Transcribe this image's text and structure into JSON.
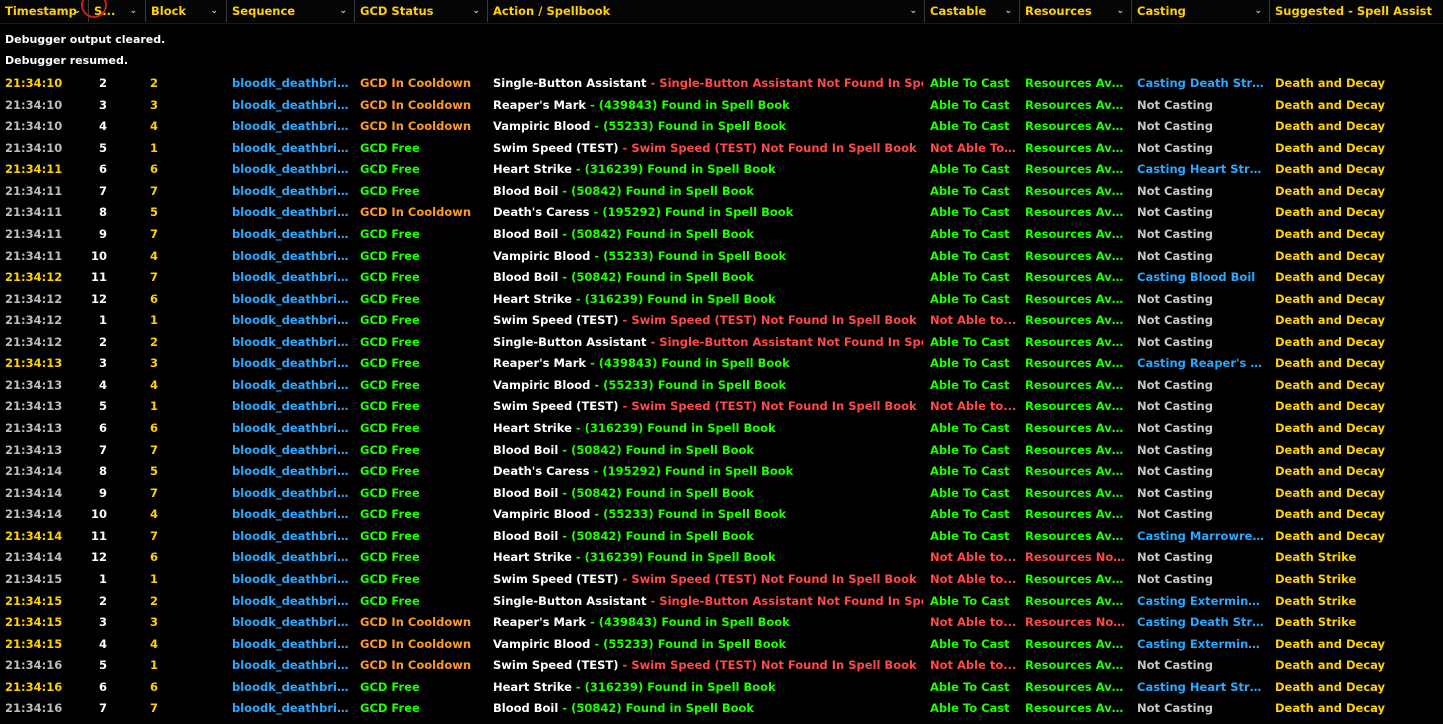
{
  "columns": [
    {
      "key": "timestamp",
      "label": "Timestamp",
      "chevron": "⌄"
    },
    {
      "key": "step",
      "label": "S...",
      "chevron": "⌄"
    },
    {
      "key": "block",
      "label": "Block",
      "chevron": "⌄"
    },
    {
      "key": "sequence",
      "label": "Sequence",
      "chevron": "⌄"
    },
    {
      "key": "gcd",
      "label": "GCD Status",
      "chevron": "⌄"
    },
    {
      "key": "action",
      "label": "Action / Spellbook",
      "chevron": "⌄"
    },
    {
      "key": "castable",
      "label": "Castable",
      "chevron": "⌄"
    },
    {
      "key": "resources",
      "label": "Resources",
      "chevron": "⌄"
    },
    {
      "key": "casting",
      "label": "Casting",
      "chevron": "⌄"
    },
    {
      "key": "suggested",
      "label": "Suggested - Spell Assist",
      "chevron": ""
    }
  ],
  "messages": [
    "Debugger output cleared.",
    "Debugger resumed."
  ],
  "colors": {
    "header": "#ffd100",
    "green": "#1eff00",
    "orange": "#ff9a22",
    "red": "#ff4848",
    "blue": "#2aa8ff",
    "grey": "#c8c8c8",
    "background": "#000000"
  },
  "rows": [
    {
      "ts": "21:34:10",
      "hl": true,
      "step": "2",
      "block": "2",
      "seq": "bloodk_deathbring...",
      "gcd": "GCD In Cooldown",
      "gcd_state": "cooldown",
      "spell": "Single-Button Assistant",
      "spell_id": "",
      "found": false,
      "spell_text": "Single-Button Assistant Not Found In Spell Book",
      "castable": "Able To Cast",
      "castable_ok": true,
      "resources": "Resources Avai...",
      "resources_ok": true,
      "casting": "Casting Death Strike",
      "is_casting": true,
      "suggested": "Death and Decay"
    },
    {
      "ts": "21:34:10",
      "hl": false,
      "step": "3",
      "block": "3",
      "seq": "bloodk_deathbring...",
      "gcd": "GCD In Cooldown",
      "gcd_state": "cooldown",
      "spell": "Reaper's Mark",
      "spell_id": "(439843)",
      "found": true,
      "spell_text": "Found in Spell Book",
      "castable": "Able To Cast",
      "castable_ok": true,
      "resources": "Resources Avai...",
      "resources_ok": true,
      "casting": "Not Casting",
      "is_casting": false,
      "suggested": "Death and Decay"
    },
    {
      "ts": "21:34:10",
      "hl": false,
      "step": "4",
      "block": "4",
      "seq": "bloodk_deathbring...",
      "gcd": "GCD In Cooldown",
      "gcd_state": "cooldown",
      "spell": "Vampiric Blood",
      "spell_id": "(55233)",
      "found": true,
      "spell_text": "Found in Spell Book",
      "castable": "Able To Cast",
      "castable_ok": true,
      "resources": "Resources Avai...",
      "resources_ok": true,
      "casting": "Not Casting",
      "is_casting": false,
      "suggested": "Death and Decay"
    },
    {
      "ts": "21:34:10",
      "hl": false,
      "step": "5",
      "block": "1",
      "seq": "bloodk_deathbring...",
      "gcd": "GCD Free",
      "gcd_state": "free",
      "spell": "Swim Speed (TEST)",
      "spell_id": "",
      "found": false,
      "spell_text": "Swim Speed (TEST) Not Found In Spell Book",
      "castable": "Not Able To Cast",
      "castable_ok": false,
      "resources": "Resources Avai...",
      "resources_ok": true,
      "casting": "Not Casting",
      "is_casting": false,
      "suggested": "Death and Decay"
    },
    {
      "ts": "21:34:11",
      "hl": true,
      "step": "6",
      "block": "6",
      "seq": "bloodk_deathbring...",
      "gcd": "GCD Free",
      "gcd_state": "free",
      "spell": "Heart Strike",
      "spell_id": "(316239)",
      "found": true,
      "spell_text": "Found in Spell Book",
      "castable": "Able To Cast",
      "castable_ok": true,
      "resources": "Resources Avai...",
      "resources_ok": true,
      "casting": "Casting Heart Strike",
      "is_casting": true,
      "suggested": "Death and Decay"
    },
    {
      "ts": "21:34:11",
      "hl": false,
      "step": "7",
      "block": "7",
      "seq": "bloodk_deathbring...",
      "gcd": "GCD Free",
      "gcd_state": "free",
      "spell": "Blood Boil",
      "spell_id": "(50842)",
      "found": true,
      "spell_text": "Found in Spell Book",
      "castable": "Able To Cast",
      "castable_ok": true,
      "resources": "Resources Avai...",
      "resources_ok": true,
      "casting": "Not Casting",
      "is_casting": false,
      "suggested": "Death and Decay"
    },
    {
      "ts": "21:34:11",
      "hl": false,
      "step": "8",
      "block": "5",
      "seq": "bloodk_deathbring...",
      "gcd": "GCD In Cooldown",
      "gcd_state": "cooldown",
      "spell": "Death's Caress",
      "spell_id": "(195292)",
      "found": true,
      "spell_text": "Found in Spell Book",
      "castable": "Able To Cast",
      "castable_ok": true,
      "resources": "Resources Avai...",
      "resources_ok": true,
      "casting": "Not Casting",
      "is_casting": false,
      "suggested": "Death and Decay"
    },
    {
      "ts": "21:34:11",
      "hl": false,
      "step": "9",
      "block": "7",
      "seq": "bloodk_deathbring...",
      "gcd": "GCD Free",
      "gcd_state": "free",
      "spell": "Blood Boil",
      "spell_id": "(50842)",
      "found": true,
      "spell_text": "Found in Spell Book",
      "castable": "Able To Cast",
      "castable_ok": true,
      "resources": "Resources Avai...",
      "resources_ok": true,
      "casting": "Not Casting",
      "is_casting": false,
      "suggested": "Death and Decay"
    },
    {
      "ts": "21:34:11",
      "hl": false,
      "step": "10",
      "block": "4",
      "seq": "bloodk_deathbring...",
      "gcd": "GCD Free",
      "gcd_state": "free",
      "spell": "Vampiric Blood",
      "spell_id": "(55233)",
      "found": true,
      "spell_text": "Found in Spell Book",
      "castable": "Able To Cast",
      "castable_ok": true,
      "resources": "Resources Avai...",
      "resources_ok": true,
      "casting": "Not Casting",
      "is_casting": false,
      "suggested": "Death and Decay"
    },
    {
      "ts": "21:34:12",
      "hl": true,
      "step": "11",
      "block": "7",
      "seq": "bloodk_deathbring...",
      "gcd": "GCD Free",
      "gcd_state": "free",
      "spell": "Blood Boil",
      "spell_id": "(50842)",
      "found": true,
      "spell_text": "Found in Spell Book",
      "castable": "Able To Cast",
      "castable_ok": true,
      "resources": "Resources Avai...",
      "resources_ok": true,
      "casting": "Casting Blood Boil",
      "is_casting": true,
      "suggested": "Death and Decay"
    },
    {
      "ts": "21:34:12",
      "hl": false,
      "step": "12",
      "block": "6",
      "seq": "bloodk_deathbring...",
      "gcd": "GCD Free",
      "gcd_state": "free",
      "spell": "Heart Strike",
      "spell_id": "(316239)",
      "found": true,
      "spell_text": "Found in Spell Book",
      "castable": "Able To Cast",
      "castable_ok": true,
      "resources": "Resources Avai...",
      "resources_ok": true,
      "casting": "Not Casting",
      "is_casting": false,
      "suggested": "Death and Decay"
    },
    {
      "ts": "21:34:12",
      "hl": false,
      "step": "1",
      "block": "1",
      "seq": "bloodk_deathbring...",
      "gcd": "GCD Free",
      "gcd_state": "free",
      "spell": "Swim Speed (TEST)",
      "spell_id": "",
      "found": false,
      "spell_text": "Swim Speed (TEST) Not Found In Spell Book",
      "castable": "Not Able to...",
      "castable_ok": false,
      "resources": "Resources Avai...",
      "resources_ok": true,
      "casting": "Not Casting",
      "is_casting": false,
      "suggested": "Death and Decay"
    },
    {
      "ts": "21:34:12",
      "hl": false,
      "step": "2",
      "block": "2",
      "seq": "bloodk_deathbring...",
      "gcd": "GCD Free",
      "gcd_state": "free",
      "spell": "Single-Button Assistant",
      "spell_id": "",
      "found": false,
      "spell_text": "Single-Button Assistant Not Found In Spell Book",
      "castable": "Able To Cast",
      "castable_ok": true,
      "resources": "Resources Avai...",
      "resources_ok": true,
      "casting": "Not Casting",
      "is_casting": false,
      "suggested": "Death and Decay"
    },
    {
      "ts": "21:34:13",
      "hl": true,
      "step": "3",
      "block": "3",
      "seq": "bloodk_deathbring...",
      "gcd": "GCD Free",
      "gcd_state": "free",
      "spell": "Reaper's Mark",
      "spell_id": "(439843)",
      "found": true,
      "spell_text": "Found in Spell Book",
      "castable": "Able To Cast",
      "castable_ok": true,
      "resources": "Resources Avai...",
      "resources_ok": true,
      "casting": "Casting Reaper's Ma...",
      "is_casting": true,
      "suggested": "Death and Decay"
    },
    {
      "ts": "21:34:13",
      "hl": false,
      "step": "4",
      "block": "4",
      "seq": "bloodk_deathbring...",
      "gcd": "GCD Free",
      "gcd_state": "free",
      "spell": "Vampiric Blood",
      "spell_id": "(55233)",
      "found": true,
      "spell_text": "Found in Spell Book",
      "castable": "Able To Cast",
      "castable_ok": true,
      "resources": "Resources Avai...",
      "resources_ok": true,
      "casting": "Not Casting",
      "is_casting": false,
      "suggested": "Death and Decay"
    },
    {
      "ts": "21:34:13",
      "hl": false,
      "step": "5",
      "block": "1",
      "seq": "bloodk_deathbring...",
      "gcd": "GCD Free",
      "gcd_state": "free",
      "spell": "Swim Speed (TEST)",
      "spell_id": "",
      "found": false,
      "spell_text": "Swim Speed (TEST) Not Found In Spell Book",
      "castable": "Not Able to...",
      "castable_ok": false,
      "resources": "Resources Avai...",
      "resources_ok": true,
      "casting": "Not Casting",
      "is_casting": false,
      "suggested": "Death and Decay"
    },
    {
      "ts": "21:34:13",
      "hl": false,
      "step": "6",
      "block": "6",
      "seq": "bloodk_deathbring...",
      "gcd": "GCD Free",
      "gcd_state": "free",
      "spell": "Heart Strike",
      "spell_id": "(316239)",
      "found": true,
      "spell_text": "Found in Spell Book",
      "castable": "Able To Cast",
      "castable_ok": true,
      "resources": "Resources Avai...",
      "resources_ok": true,
      "casting": "Not Casting",
      "is_casting": false,
      "suggested": "Death and Decay"
    },
    {
      "ts": "21:34:13",
      "hl": false,
      "step": "7",
      "block": "7",
      "seq": "bloodk_deathbring...",
      "gcd": "GCD Free",
      "gcd_state": "free",
      "spell": "Blood Boil",
      "spell_id": "(50842)",
      "found": true,
      "spell_text": "Found in Spell Book",
      "castable": "Able To Cast",
      "castable_ok": true,
      "resources": "Resources Avai...",
      "resources_ok": true,
      "casting": "Not Casting",
      "is_casting": false,
      "suggested": "Death and Decay"
    },
    {
      "ts": "21:34:14",
      "hl": false,
      "step": "8",
      "block": "5",
      "seq": "bloodk_deathbring...",
      "gcd": "GCD Free",
      "gcd_state": "free",
      "spell": "Death's Caress",
      "spell_id": "(195292)",
      "found": true,
      "spell_text": "Found in Spell Book",
      "castable": "Able To Cast",
      "castable_ok": true,
      "resources": "Resources Avai...",
      "resources_ok": true,
      "casting": "Not Casting",
      "is_casting": false,
      "suggested": "Death and Decay"
    },
    {
      "ts": "21:34:14",
      "hl": false,
      "step": "9",
      "block": "7",
      "seq": "bloodk_deathbring...",
      "gcd": "GCD Free",
      "gcd_state": "free",
      "spell": "Blood Boil",
      "spell_id": "(50842)",
      "found": true,
      "spell_text": "Found in Spell Book",
      "castable": "Able To Cast",
      "castable_ok": true,
      "resources": "Resources Avai...",
      "resources_ok": true,
      "casting": "Not Casting",
      "is_casting": false,
      "suggested": "Death and Decay"
    },
    {
      "ts": "21:34:14",
      "hl": false,
      "step": "10",
      "block": "4",
      "seq": "bloodk_deathbring...",
      "gcd": "GCD Free",
      "gcd_state": "free",
      "spell": "Vampiric Blood",
      "spell_id": "(55233)",
      "found": true,
      "spell_text": "Found in Spell Book",
      "castable": "Able To Cast",
      "castable_ok": true,
      "resources": "Resources Avai...",
      "resources_ok": true,
      "casting": "Not Casting",
      "is_casting": false,
      "suggested": "Death and Decay"
    },
    {
      "ts": "21:34:14",
      "hl": true,
      "step": "11",
      "block": "7",
      "seq": "bloodk_deathbring...",
      "gcd": "GCD Free",
      "gcd_state": "free",
      "spell": "Blood Boil",
      "spell_id": "(50842)",
      "found": true,
      "spell_text": "Found in Spell Book",
      "castable": "Able To Cast",
      "castable_ok": true,
      "resources": "Resources Avai...",
      "resources_ok": true,
      "casting": "Casting Marrowrend",
      "is_casting": true,
      "suggested": "Death and Decay"
    },
    {
      "ts": "21:34:14",
      "hl": false,
      "step": "12",
      "block": "6",
      "seq": "bloodk_deathbring...",
      "gcd": "GCD Free",
      "gcd_state": "free",
      "spell": "Heart Strike",
      "spell_id": "(316239)",
      "found": true,
      "spell_text": "Found in Spell Book",
      "castable": "Not Able to...",
      "castable_ok": false,
      "resources": "Resources Not...",
      "resources_ok": false,
      "casting": "Not Casting",
      "is_casting": false,
      "suggested": "Death Strike"
    },
    {
      "ts": "21:34:15",
      "hl": false,
      "step": "1",
      "block": "1",
      "seq": "bloodk_deathbring...",
      "gcd": "GCD Free",
      "gcd_state": "free",
      "spell": "Swim Speed (TEST)",
      "spell_id": "",
      "found": false,
      "spell_text": "Swim Speed (TEST) Not Found In Spell Book",
      "castable": "Not Able to...",
      "castable_ok": false,
      "resources": "Resources Avai...",
      "resources_ok": true,
      "casting": "Not Casting",
      "is_casting": false,
      "suggested": "Death Strike"
    },
    {
      "ts": "21:34:15",
      "hl": true,
      "step": "2",
      "block": "2",
      "seq": "bloodk_deathbring...",
      "gcd": "GCD Free",
      "gcd_state": "free",
      "spell": "Single-Button Assistant",
      "spell_id": "",
      "found": false,
      "spell_text": "Single-Button Assistant Not Found In Spell Book",
      "castable": "Able To Cast",
      "castable_ok": true,
      "resources": "Resources Avai...",
      "resources_ok": true,
      "casting": "Casting Exterminate",
      "is_casting": true,
      "suggested": "Death Strike"
    },
    {
      "ts": "21:34:15",
      "hl": true,
      "step": "3",
      "block": "3",
      "seq": "bloodk_deathbring...",
      "gcd": "GCD In Cooldown",
      "gcd_state": "cooldown",
      "spell": "Reaper's Mark",
      "spell_id": "(439843)",
      "found": true,
      "spell_text": "Found in Spell Book",
      "castable": "Not Able to...",
      "castable_ok": false,
      "resources": "Resources Not...",
      "resources_ok": false,
      "casting": "Casting Death Strike",
      "is_casting": true,
      "suggested": "Death Strike"
    },
    {
      "ts": "21:34:15",
      "hl": true,
      "step": "4",
      "block": "4",
      "seq": "bloodk_deathbring...",
      "gcd": "GCD In Cooldown",
      "gcd_state": "cooldown",
      "spell": "Vampiric Blood",
      "spell_id": "(55233)",
      "found": true,
      "spell_text": "Found in Spell Book",
      "castable": "Able To Cast",
      "castable_ok": true,
      "resources": "Resources Avai...",
      "resources_ok": true,
      "casting": "Casting Exterminate",
      "is_casting": true,
      "suggested": "Death and Decay"
    },
    {
      "ts": "21:34:16",
      "hl": false,
      "step": "5",
      "block": "1",
      "seq": "bloodk_deathbring...",
      "gcd": "GCD In Cooldown",
      "gcd_state": "cooldown",
      "spell": "Swim Speed (TEST)",
      "spell_id": "",
      "found": false,
      "spell_text": "Swim Speed (TEST) Not Found In Spell Book",
      "castable": "Not Able to...",
      "castable_ok": false,
      "resources": "Resources Avai...",
      "resources_ok": true,
      "casting": "Not Casting",
      "is_casting": false,
      "suggested": "Death and Decay"
    },
    {
      "ts": "21:34:16",
      "hl": true,
      "step": "6",
      "block": "6",
      "seq": "bloodk_deathbring...",
      "gcd": "GCD Free",
      "gcd_state": "free",
      "spell": "Heart Strike",
      "spell_id": "(316239)",
      "found": true,
      "spell_text": "Found in Spell Book",
      "castable": "Able To Cast",
      "castable_ok": true,
      "resources": "Resources Avai...",
      "resources_ok": true,
      "casting": "Casting Heart Strike",
      "is_casting": true,
      "suggested": "Death and Decay"
    },
    {
      "ts": "21:34:16",
      "hl": false,
      "step": "7",
      "block": "7",
      "seq": "bloodk_deathbring...",
      "gcd": "GCD Free",
      "gcd_state": "free",
      "spell": "Blood Boil",
      "spell_id": "(50842)",
      "found": true,
      "spell_text": "Found in Spell Book",
      "castable": "Able To Cast",
      "castable_ok": true,
      "resources": "Resources Avai...",
      "resources_ok": true,
      "casting": "Not Casting",
      "is_casting": false,
      "suggested": "Death and Decay"
    }
  ]
}
